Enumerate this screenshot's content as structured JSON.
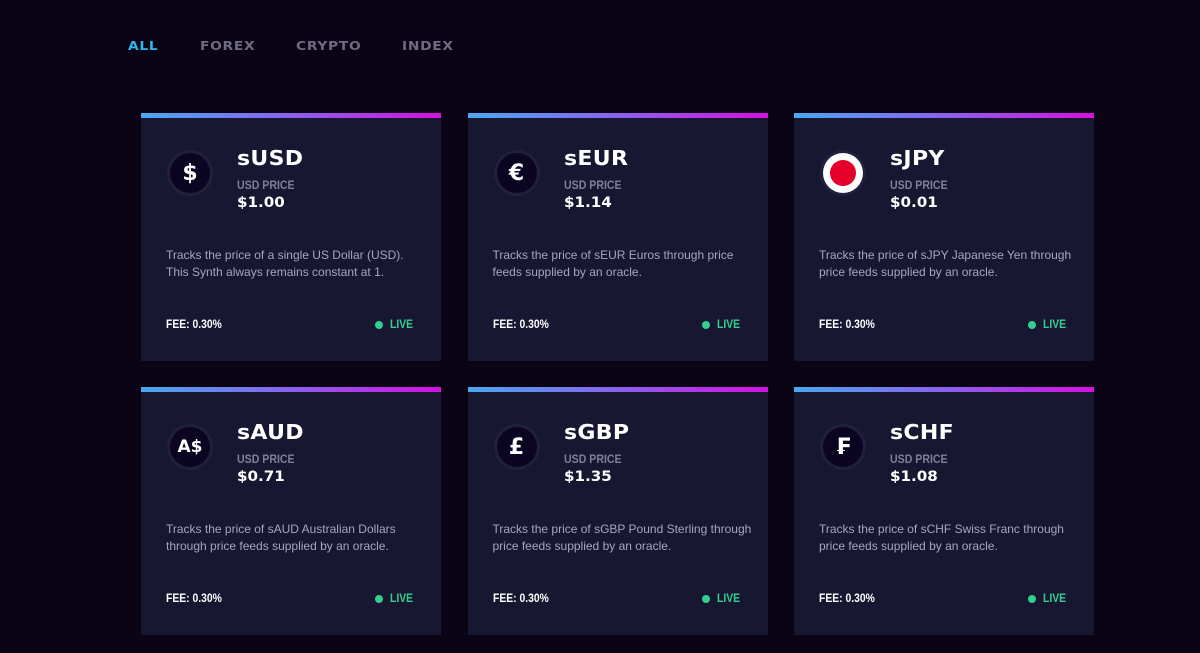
{
  "tabs": [
    {
      "label": "ALL",
      "active": true
    },
    {
      "label": "FOREX",
      "active": false
    },
    {
      "label": "CRYPTO",
      "active": false
    },
    {
      "label": "INDEX",
      "active": false
    }
  ],
  "colors": {
    "accent": "#2fb8f0",
    "live": "#31d08e",
    "gradient_start": "#4aa8f0",
    "gradient_end": "#d511e0"
  },
  "price_label": "USD PRICE",
  "cards": [
    {
      "name": "sUSD",
      "icon": "dollar-icon",
      "glyph": "$",
      "price": "$1.00",
      "description": "Tracks the price of a single US Dollar (USD). This Synth always remains constant at 1.",
      "fee": "FEE: 0.30%",
      "status": "LIVE"
    },
    {
      "name": "sEUR",
      "icon": "euro-icon",
      "glyph": "€",
      "price": "$1.14",
      "description": "Tracks the price of sEUR Euros through price feeds supplied by an oracle.",
      "fee": "FEE: 0.30%",
      "status": "LIVE"
    },
    {
      "name": "sJPY",
      "icon": "japan-flag-icon",
      "glyph": "",
      "price": "$0.01",
      "description": "Tracks the price of sJPY Japanese Yen through price feeds supplied by an oracle.",
      "fee": "FEE: 0.30%",
      "status": "LIVE"
    },
    {
      "name": "sAUD",
      "icon": "australian-dollar-icon",
      "glyph": "A$",
      "price": "$0.71",
      "description": "Tracks the price of sAUD Australian Dollars through price feeds supplied by an oracle.",
      "fee": "FEE: 0.30%",
      "status": "LIVE"
    },
    {
      "name": "sGBP",
      "icon": "pound-icon",
      "glyph": "£",
      "price": "$1.35",
      "description": "Tracks the price of sGBP Pound Sterling through price feeds supplied by an oracle.",
      "fee": "FEE: 0.30%",
      "status": "LIVE"
    },
    {
      "name": "sCHF",
      "icon": "franc-icon",
      "glyph": "₣",
      "price": "$1.08",
      "description": "Tracks the price of sCHF Swiss Franc through price feeds supplied by an oracle.",
      "fee": "FEE: 0.30%",
      "status": "LIVE"
    }
  ]
}
